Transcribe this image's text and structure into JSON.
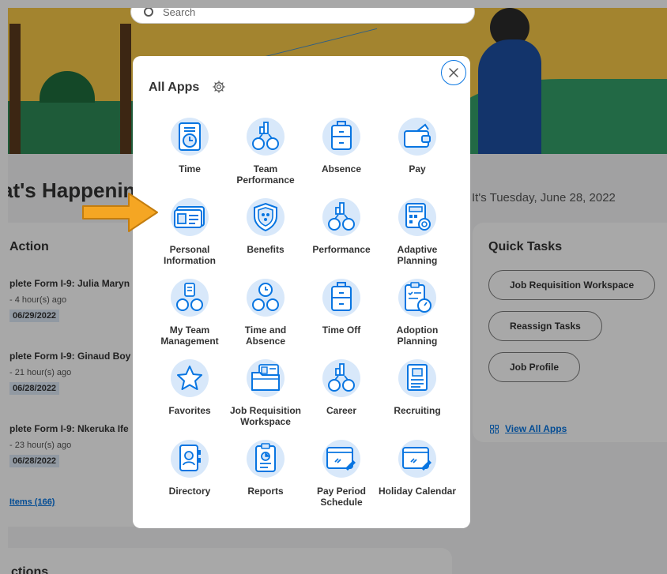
{
  "background": {
    "search_placeholder": "Search",
    "happening_title": "at's Happening",
    "date_text": "It's Tuesday, June 28, 2022",
    "action_title": "Action",
    "tasks": [
      {
        "title": "plete Form I-9: Julia Maryn",
        "time": "- 4 hour(s) ago",
        "date": "06/29/2022"
      },
      {
        "title": "plete Form I-9: Ginaud Boy",
        "time": "- 21 hour(s) ago",
        "date": "06/28/2022"
      },
      {
        "title": "plete Form I-9: Nkeruka Ife",
        "time": "- 23 hour(s) ago",
        "date": "06/28/2022"
      }
    ],
    "items_link": "Items (166)",
    "quick_tasks": {
      "title": "Quick Tasks",
      "buttons": [
        "Job Requisition Workspace",
        "Reassign Tasks",
        "Job Profile"
      ],
      "view_all": "View All Apps"
    },
    "bottom_title": "ctions"
  },
  "modal": {
    "title": "All Apps",
    "gear_icon": "gear-icon",
    "close_icon": "close-icon",
    "accent_color": "#0875e1",
    "icon_bg_color": "#d8e8fa",
    "apps": [
      {
        "label": "Time",
        "icon": "clock-doc-icon"
      },
      {
        "label": "Team Performance",
        "icon": "team-chart-icon"
      },
      {
        "label": "Absence",
        "icon": "suitcase-icon"
      },
      {
        "label": "Pay",
        "icon": "wallet-icon"
      },
      {
        "label": "Personal Information",
        "icon": "id-card-icon"
      },
      {
        "label": "Benefits",
        "icon": "shield-icon"
      },
      {
        "label": "Performance",
        "icon": "team-chart-icon"
      },
      {
        "label": "Adaptive Planning",
        "icon": "calculator-icon"
      },
      {
        "label": "My Team Management",
        "icon": "team-list-icon"
      },
      {
        "label": "Time and Absence",
        "icon": "team-clock-icon"
      },
      {
        "label": "Time Off",
        "icon": "suitcase-icon"
      },
      {
        "label": "Adoption Planning",
        "icon": "clipboard-gauge-icon"
      },
      {
        "label": "Favorites",
        "icon": "star-icon"
      },
      {
        "label": "Job Requisition Workspace",
        "icon": "folder-icon"
      },
      {
        "label": "Career",
        "icon": "team-chart-icon"
      },
      {
        "label": "Recruiting",
        "icon": "resume-icon"
      },
      {
        "label": "Directory",
        "icon": "address-book-icon"
      },
      {
        "label": "Reports",
        "icon": "report-icon"
      },
      {
        "label": "Pay Period Schedule",
        "icon": "browser-link-icon"
      },
      {
        "label": "Holiday Calendar",
        "icon": "browser-link-icon"
      }
    ]
  },
  "annotation": {
    "arrow_color": "#f5a623",
    "arrow_icon": "arrow-right-icon"
  }
}
